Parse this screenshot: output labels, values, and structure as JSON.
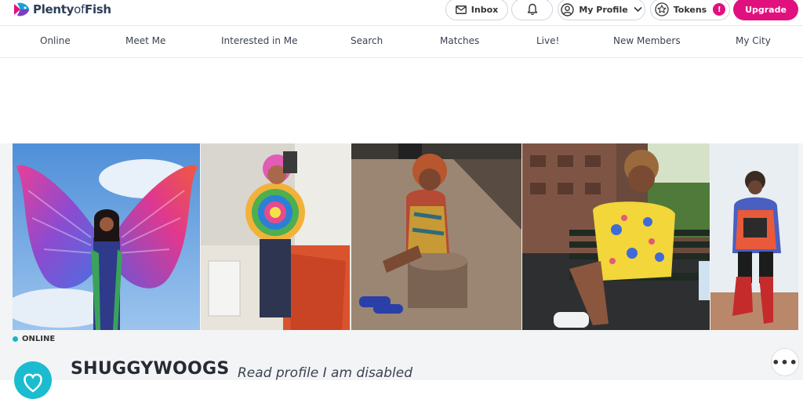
{
  "header": {
    "logo_text_a": "Plenty",
    "logo_text_b": "of",
    "logo_text_c": "Fish",
    "inbox_label": "Inbox",
    "profile_label": "My Profile",
    "tokens_label": "Tokens",
    "tokens_badge": "!",
    "upgrade_label": "Upgrade"
  },
  "nav": {
    "items": [
      {
        "label": "Online"
      },
      {
        "label": "Meet Me"
      },
      {
        "label": "Interested in Me"
      },
      {
        "label": "Search"
      },
      {
        "label": "Matches"
      },
      {
        "label": "Live!"
      },
      {
        "label": "New Members"
      },
      {
        "label": "My City"
      }
    ]
  },
  "profile": {
    "status": "ONLINE",
    "username": "SHUGGYWOOGS",
    "tagline": "Read profile I am disabled",
    "more": "•••"
  },
  "colors": {
    "accent": "#e0117f",
    "online": "#17b5c9",
    "avatar_bg": "#1bbcd0"
  },
  "icons": [
    "envelope-icon",
    "bell-icon",
    "user-circle-icon",
    "chevron-down-icon",
    "star-icon",
    "more-icon"
  ]
}
